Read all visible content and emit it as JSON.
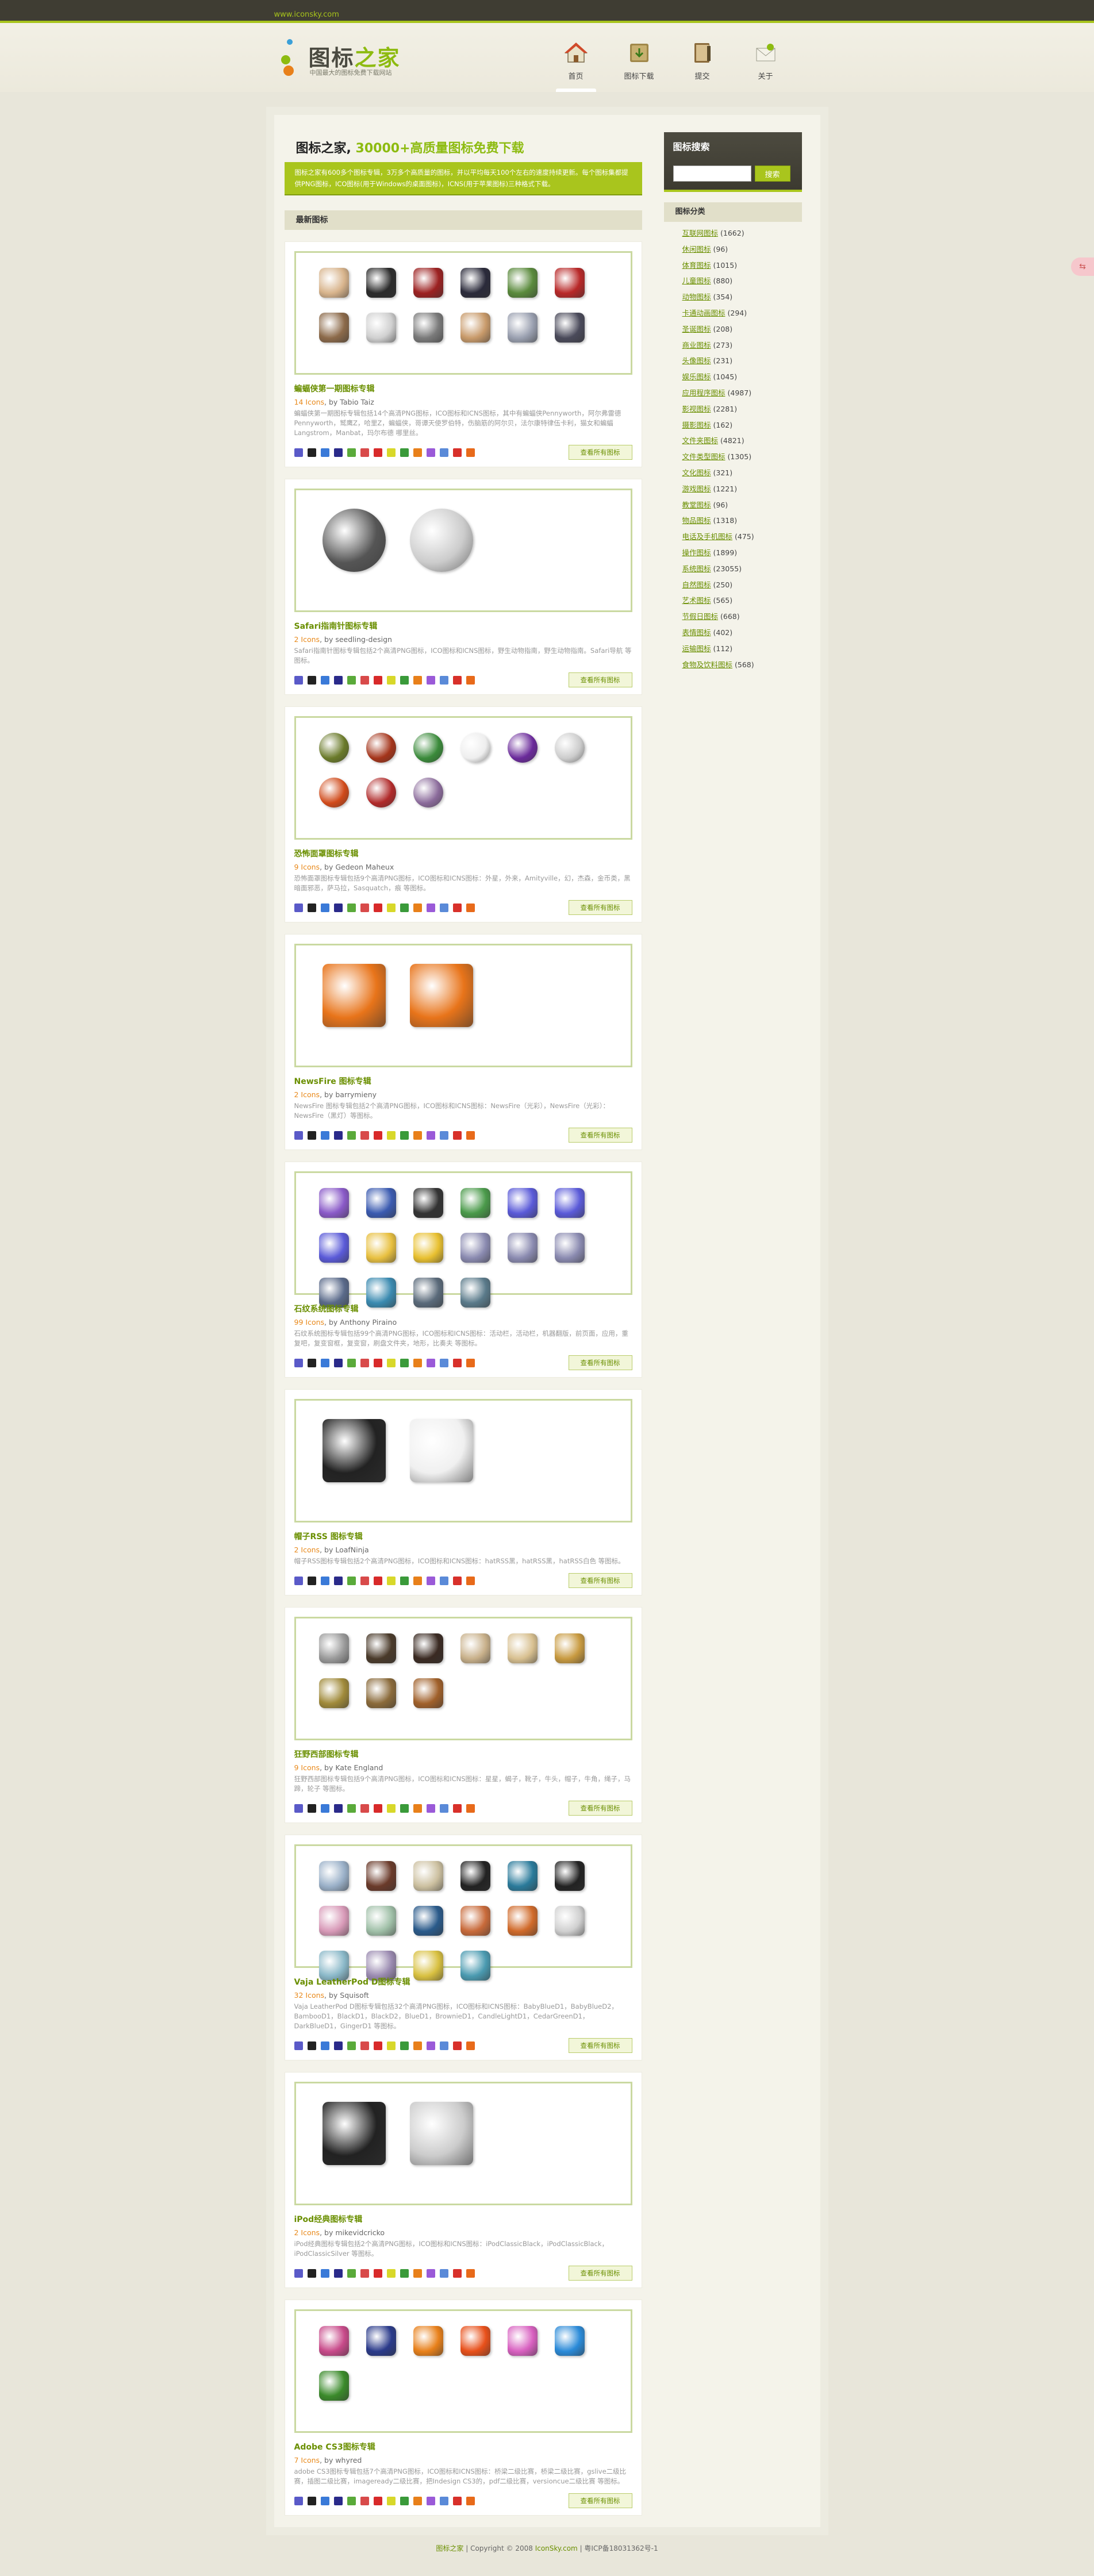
{
  "topbar": {
    "site_url": "www.iconsky.com"
  },
  "logo": {
    "title_main": "图标",
    "title_accent": "之家",
    "subtitle": "中国最大的图标免费下载网站"
  },
  "nav": [
    {
      "label": "首页",
      "icon": "house-icon",
      "active": true
    },
    {
      "label": "图标下载",
      "icon": "download-book-icon",
      "active": false
    },
    {
      "label": "提交",
      "icon": "submit-book-icon",
      "active": false
    },
    {
      "label": "关于",
      "icon": "about-envelope-icon",
      "active": false
    }
  ],
  "intro": {
    "title_main": "图标之家, ",
    "title_accent": "30000+高质量图标免费下载",
    "text": "图标之家有600多个图标专辑，3万多个高质量的图标，并以平均每天100个左右的速度持续更新。每个图标集都提供PNG图标，ICO图标(用于Windows的桌面图标)，ICNS(用于苹果图标)三种格式下载。"
  },
  "latest_heading": "最新图标",
  "sets": [
    {
      "title": "蝙蝠侠第一期图标专辑",
      "count": "14 Icons",
      "author": ", by Tabio Taiz",
      "desc": "蝙蝠侠第一期图标专辑包括14个高清PNG图标，ICO图标和ICNS图标，其中有蝙蝠侠Pennyworth，阿尔弗雷德Pennyworth，鹫鹰Z，哈里Z，蝙蝠侠，哥谭天使罗伯特，伤脑筋的阿尔贝，法尔康特律伍卡利，猫女和蝙蝠Langstrom，Manbat，玛尔布德 哪里丝。",
      "icons": [
        "bald-villain-icon",
        "ninja-icon",
        "mask-villain-icon",
        "batman-icon",
        "joker-icon",
        "woman-villain-icon",
        "bald-man-icon",
        "old-man-icon",
        "gargoyle-icon",
        "catwoman-icon",
        "robot-icon",
        "rogue-icon"
      ],
      "palette": [
        "#d8b48c",
        "#2b2b2b",
        "#9c2121",
        "#2a2a3a",
        "#5a8a3c",
        "#b82828",
        "#8c6a4a",
        "#d0d0d0",
        "#7a7a7a",
        "#c89a6a",
        "#9aa0b0",
        "#4a4a5a"
      ]
    },
    {
      "title": "Safari指南针图标专辑",
      "count": "2 Icons",
      "author": ", by seedling-design",
      "desc": "Safari指南针图标专辑包括2个高清PNG图标，ICO图标和ICNS图标，野生动物指南，野生动物指南。Safari导航 等图标。",
      "icons": [
        "compass-dark-icon",
        "compass-light-icon"
      ],
      "palette": [
        "#555555",
        "#cccccc"
      ]
    },
    {
      "title": "恐怖面罩图标专辑",
      "count": "9 Icons",
      "author": ", by Gedeon Maheux",
      "desc": "恐怖面罩图标专辑包括9个高清PNG图标，ICO图标和ICNS图标：外星，外来，Amityville，幻，杰森，金币类，黑暗面邪恶，萨马拉，Sasquatch，痕 等图标。",
      "icons": [
        "alien-mask-icon",
        "cross-mask-icon",
        "clown-mask-icon",
        "hockey-mask-icon",
        "purple-mask-icon",
        "ghost-mask-icon",
        "fire-mask-icon",
        "red-mask-icon",
        "zombie-mask-icon"
      ],
      "palette": [
        "#6a7a2a",
        "#a4341a",
        "#3a8a3a",
        "#eeeeee",
        "#6a2a9a",
        "#cccccc",
        "#d04a1a",
        "#b02a2a",
        "#8a6a9a"
      ]
    },
    {
      "title": "NewsFire 图标专辑",
      "count": "2 Icons",
      "author": ", by barrymieny",
      "desc": "NewsFire 图标专辑包括2个高清PNG图标，ICO图标和ICNS图标：NewsFire（光彩），NewsFire（光彩）：NewsFire（黑灯）等图标。",
      "icons": [
        "rss-fire-icon",
        "rss-fire-alt-icon"
      ],
      "palette": [
        "#e8741a",
        "#e8741a"
      ]
    },
    {
      "title": "石纹系统图标专辑",
      "count": "99 Icons",
      "author": ", by Anthony Piraino",
      "desc": "石纹系统图标专辑包括99个高清PNG图标，ICO图标和ICNS图标：活动栏，活动栏，机器翻版，前页面，应用，重复吧，复变窗框，复变窗，刷盘文件夹，地形，比奏夫 等图标。",
      "icons": [
        "email-icon",
        "wifi-icon",
        "font-icon",
        "apps-icon",
        "disc-icon",
        "disc2-icon",
        "disc3-icon",
        "folder-icon",
        "radiation-icon",
        "disc4-icon",
        "disc5-icon",
        "disc6-icon",
        "monitor-icon",
        "help-icon",
        "wrench-icon",
        "clock-icon"
      ],
      "palette": [
        "#8a5ac8",
        "#3a5ab0",
        "#333333",
        "#4a9a4a",
        "#5a5ad8",
        "#5a5ad8",
        "#5a5ad8",
        "#e8c040",
        "#e8c030",
        "#8a8ab0",
        "#8a8ab0",
        "#8a8ab0",
        "#5a6a8a",
        "#3a8ab0",
        "#5a6a7a",
        "#5a7a8a"
      ]
    },
    {
      "title": "帽子RSS 图标专辑",
      "count": "2 Icons",
      "author": ", by LoafNinja",
      "desc": "帽子RSS图标专辑包括2个高清PNG图标，ICO图标和ICNS图标：hatRSS黑，hatRSS黑，hatRSS白色 等图标。",
      "icons": [
        "black-hat-icon",
        "white-hat-icon"
      ],
      "palette": [
        "#222222",
        "#f0f0f0"
      ]
    },
    {
      "title": "狂野西部图标专辑",
      "count": "9 Icons",
      "author": ", by Kate England",
      "desc": "狂野西部图标专辑包括9个高清PNG图标，ICO图标和ICNS图标：星星，蝎子，靴子，牛头，帽子，牛角，绳子，马蹄，轮子 等图标。",
      "icons": [
        "sheriff-star-icon",
        "scorpion-icon",
        "boots-icon",
        "skull-icon",
        "cowboy-hat-icon",
        "pocket-watch-icon",
        "lasso-icon",
        "horseshoe-icon",
        "wagon-wheel-icon"
      ],
      "palette": [
        "#9a9a9a",
        "#4a3a2a",
        "#3a2a22",
        "#c8b08a",
        "#d8c090",
        "#c89a40",
        "#a08a3a",
        "#8a6a3a",
        "#a0602a"
      ]
    },
    {
      "title": "Vaja LeatherPod D图标专辑",
      "count": "32 Icons",
      "author": ", by Squisoft",
      "desc": "Vaja LeatherPod D图标专辑包括32个高清PNG图标，ICO图标和ICNS图标：BabyBlueD1，BabyBlueD2，BambooD1，BlackD1，BlackD2，BlueD1，BrownieD1，CandleLightD1，CedarGreenD1，DarkBlueD1，GingerD1 等图标。",
      "icons": [
        "ipod-1-icon",
        "ipod-2-icon",
        "ipod-3-icon",
        "ipod-4-icon",
        "ipod-5-icon",
        "ipod-6-icon",
        "ipod-7-icon",
        "ipod-8-icon",
        "ipod-9-icon",
        "ipod-10-icon",
        "ipod-11-icon",
        "ipod-12-icon",
        "ipod-13-icon",
        "ipod-14-icon",
        "ipod-15-icon",
        "ipod-16-icon"
      ],
      "palette": [
        "#9ab0c8",
        "#6a3a2a",
        "#ccc0a0",
        "#222222",
        "#2a7a9a",
        "#222222",
        "#d89ab8",
        "#a0c0a8",
        "#2a5a8a",
        "#c86a3a",
        "#d06a2a",
        "#d0d0d0",
        "#8ab8c8",
        "#9a8ab0",
        "#d8c040",
        "#4a9ab0"
      ]
    },
    {
      "title": "iPod经典图标专辑",
      "count": "2 Icons",
      "author": ", by mikevidcricko",
      "desc": "iPod经典图标专辑包括2个高清PNG图标，ICO图标和ICNS图标：iPodClassicBlack，iPodClassicBlack，iPodClassicSilver 等图标。",
      "icons": [
        "ipod-black-icon",
        "ipod-silver-icon"
      ],
      "palette": [
        "#222222",
        "#cccccc"
      ]
    },
    {
      "title": "Adobe CS3图标专辑",
      "count": "7 Icons",
      "author": ", by whyred",
      "desc": "adobe CS3图标专辑包括7个高清PNG图标，ICO图标和ICNS图标：桥梁二级比赛，桥梁二级比赛，gslive二级比赛，插图二级比赛，imageready二级比赛，把Indesign CS3的，pdf二级比赛，versioncue二级比赛 等图标。",
      "icons": [
        "bridge-flower-icon",
        "star-icon",
        "orange-flower-icon",
        "feather-icon",
        "butterfly-icon",
        "blue-feather-icon",
        "green-leaf-icon"
      ],
      "palette": [
        "#c84a8a",
        "#2a3a8a",
        "#e8801a",
        "#e8501a",
        "#d860c0",
        "#2a8ad8",
        "#3a8a2a"
      ]
    }
  ],
  "share_icons": [
    "#5a5ac8",
    "#222222",
    "#3a7ad8",
    "#2a2a8a",
    "#5aaa3a",
    "#d84a4a",
    "#d82a2a",
    "#d8d82a",
    "#3a9a3a",
    "#e8801a",
    "#9a5ad8",
    "#5a8ad8",
    "#d8302a",
    "#e86a1a"
  ],
  "view_all_label": "查看所有图标",
  "search": {
    "title": "图标搜索",
    "placeholder": "",
    "button": "搜索"
  },
  "categories_heading": "图标分类",
  "categories": [
    {
      "name": "互联网图标",
      "count": "(1662)"
    },
    {
      "name": "休闲图标",
      "count": "(96)"
    },
    {
      "name": "体育图标",
      "count": "(1015)"
    },
    {
      "name": "儿童图标",
      "count": "(880)"
    },
    {
      "name": "动物图标",
      "count": "(354)"
    },
    {
      "name": "卡通动画图标",
      "count": "(294)"
    },
    {
      "name": "圣诞图标",
      "count": "(208)"
    },
    {
      "name": "商业图标",
      "count": "(273)"
    },
    {
      "name": "头像图标",
      "count": "(231)"
    },
    {
      "name": "娱乐图标",
      "count": "(1045)"
    },
    {
      "name": "应用程序图标",
      "count": "(4987)"
    },
    {
      "name": "影视图标",
      "count": "(2281)"
    },
    {
      "name": "摄影图标",
      "count": "(162)"
    },
    {
      "name": "文件夹图标",
      "count": "(4821)"
    },
    {
      "name": "文件类型图标",
      "count": "(1305)"
    },
    {
      "name": "文化图标",
      "count": "(321)"
    },
    {
      "name": "游戏图标",
      "count": "(1221)"
    },
    {
      "name": "教堂图标",
      "count": "(96)"
    },
    {
      "name": "物品图标",
      "count": "(1318)"
    },
    {
      "name": "电话及手机图标",
      "count": "(475)"
    },
    {
      "name": "操作图标",
      "count": "(1899)"
    },
    {
      "name": "系统图标",
      "count": "(23055)"
    },
    {
      "name": "自然图标",
      "count": "(250)"
    },
    {
      "name": "艺术图标",
      "count": "(565)"
    },
    {
      "name": "节假日图标",
      "count": "(668)"
    },
    {
      "name": "表情图标",
      "count": "(402)"
    },
    {
      "name": "运输图标",
      "count": "(112)"
    },
    {
      "name": "食物及饮料图标",
      "count": "(568)"
    }
  ],
  "footer": {
    "site": "图标之家",
    "copyright": " | Copyright © 2008 ",
    "domain": "IconSky.com",
    "icp": " | 粤ICP备18031362号-1"
  }
}
